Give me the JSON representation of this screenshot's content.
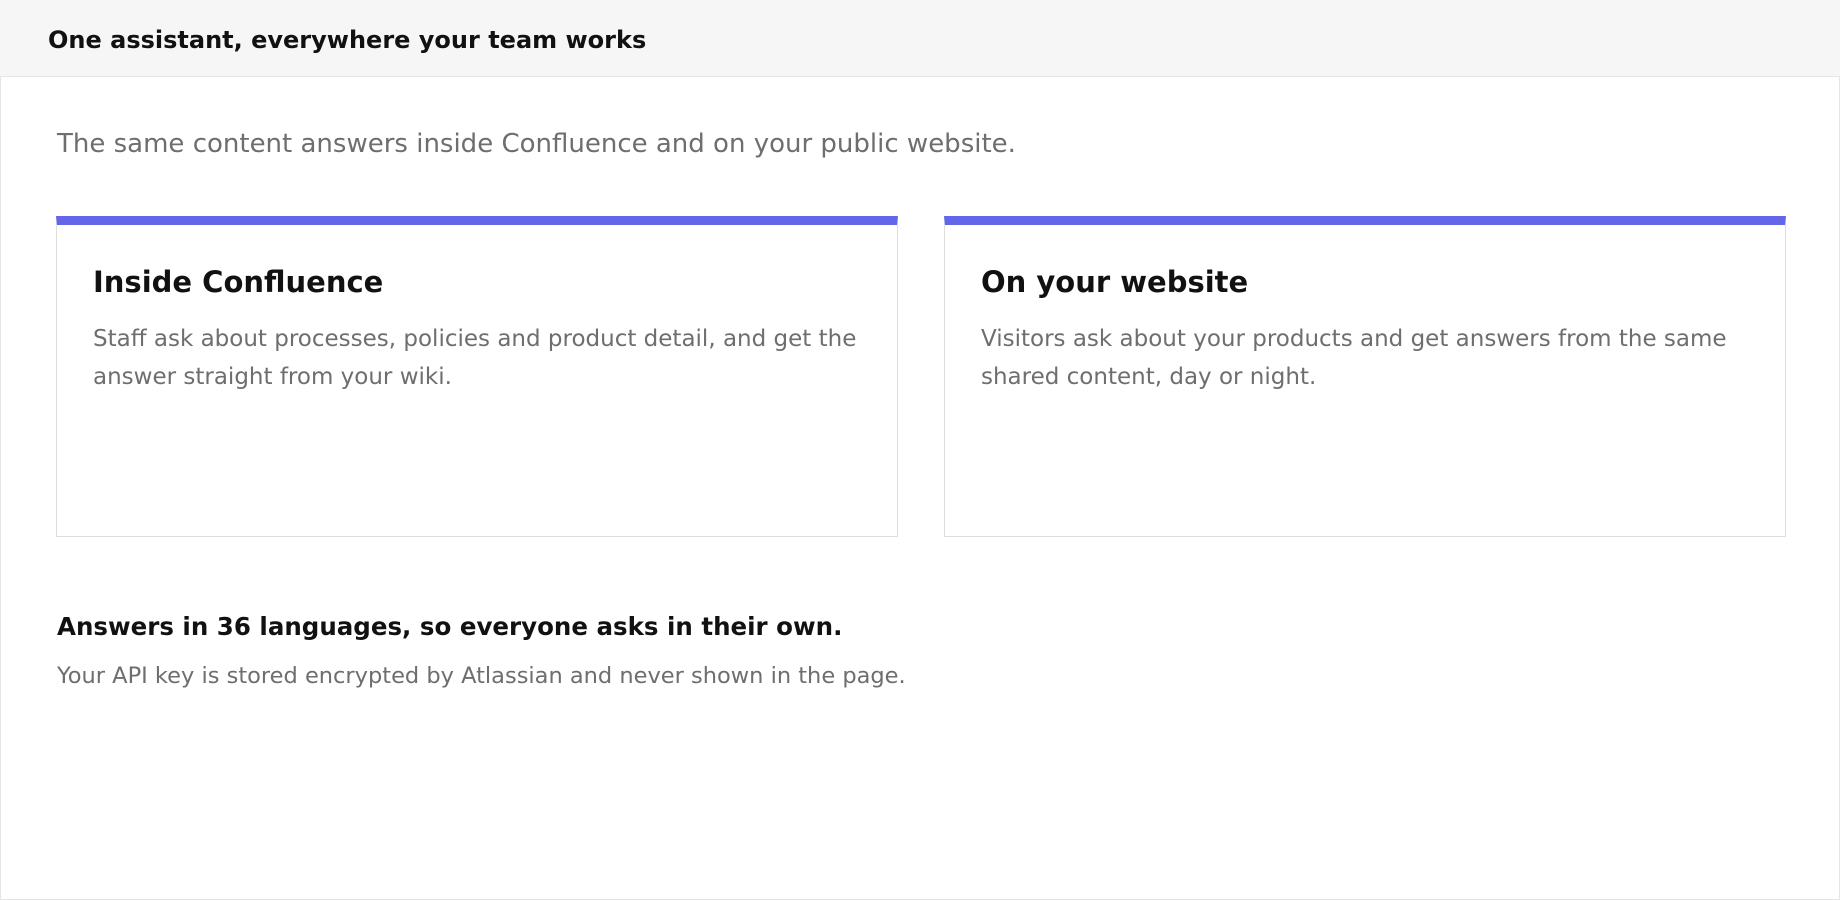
{
  "header": {
    "title": "One assistant, everywhere your team works"
  },
  "main": {
    "intro": "The same content answers inside Confluence and on your public website.",
    "cards": [
      {
        "title": "Inside Confluence",
        "text": "Staff ask about processes, policies and product detail, and get the answer straight from your wiki."
      },
      {
        "title": "On your website",
        "text": "Visitors ask about your products and get answers from the same shared content, day or night."
      }
    ],
    "languages_note": "Answers in 36 languages, so everyone asks in their own.",
    "security_note": "Your API key is stored encrypted by Atlassian and never shown in the page."
  },
  "colors": {
    "accent": "#6466e9",
    "header_bg": "#f6f6f6",
    "muted_text": "#6e6e6e"
  }
}
